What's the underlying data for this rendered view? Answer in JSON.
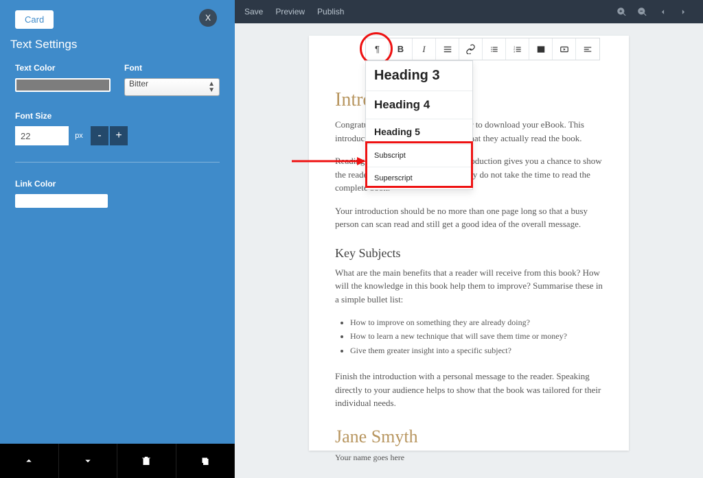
{
  "sidebar": {
    "card_label": "Card",
    "close_label": "X",
    "title": "Text Settings",
    "text_color_label": "Text Color",
    "text_color_hex": "#7d7d7d",
    "font_label": "Font",
    "font_value": "Bitter",
    "font_size_label": "Font Size",
    "font_size_value": "22",
    "font_size_unit": "px",
    "minus": "-",
    "plus": "+",
    "link_color_label": "Link Color",
    "link_color_hex": "#ffffff"
  },
  "topbar": {
    "save": "Save",
    "preview": "Preview",
    "publish": "Publish"
  },
  "toolbar": {
    "paragraph": "¶",
    "bold": "B",
    "italic": "I"
  },
  "dropdown": {
    "h3": "Heading 3",
    "h4": "Heading 4",
    "h5": "Heading 5",
    "sub": "Subscript",
    "sup": "Superscript"
  },
  "doc": {
    "intro_heading": "Introduction",
    "p1": "Congratulations on getting your reader to download your eBook. This introduction is where you make sure that they actually read the book.",
    "p2": "Reading a book is a big task. This introduction gives you a chance to show the reader that they will miss out if they do not take the time to read the complete book.",
    "p3": "Your introduction should be no more than one page long so that a busy person can scan read and still get a good idea of the overall message.",
    "key_heading": "Key Subjects",
    "p4": "What are the main benefits that a reader will receive from this book? How will the knowledge in this book help them to improve? Summarise these in a simple bullet list:",
    "li1": "How to improve on something they are already doing?",
    "li2": "How to learn a new technique that will save them time or money?",
    "li3": "Give them greater insight into a specific subject?",
    "p5": "Finish the introduction with a personal message to the reader. Speaking directly to your audience helps to show that the book was tailored for their individual needs.",
    "signature": "Jane Smyth",
    "signature_sub": "Your name goes here"
  }
}
